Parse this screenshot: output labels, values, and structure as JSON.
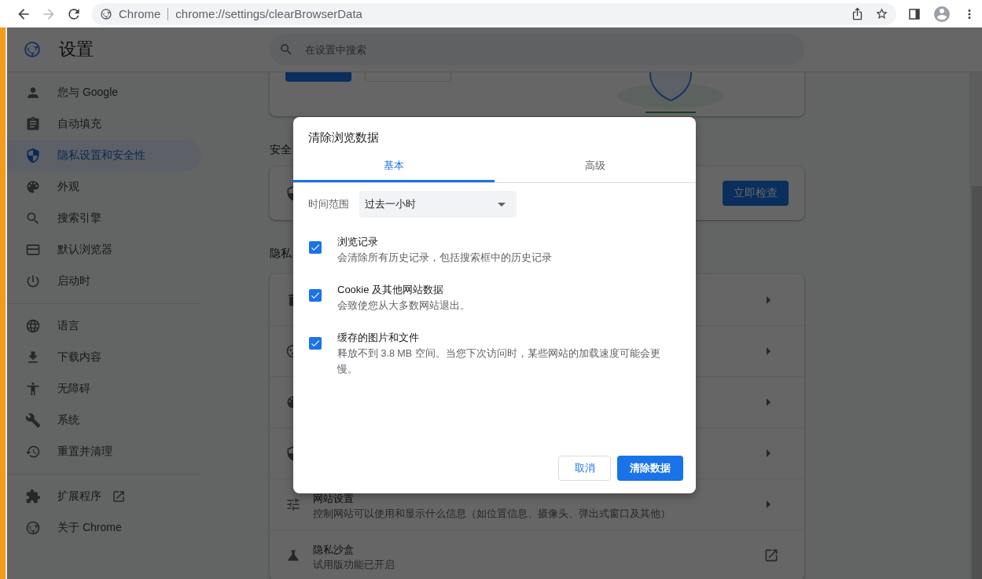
{
  "toolbar": {
    "back_disabled": false,
    "forward_disabled": true,
    "site_label": "Chrome",
    "url": "chrome://settings/clearBrowserData"
  },
  "header": {
    "title": "设置",
    "search_placeholder": "在设置中搜索"
  },
  "sidebar": {
    "groups": [
      [
        {
          "label": "您与 Google",
          "selected": false
        },
        {
          "label": "自动填充",
          "selected": false
        },
        {
          "label": "隐私设置和安全性",
          "selected": true
        },
        {
          "label": "外观",
          "selected": false
        },
        {
          "label": "搜索引擎",
          "selected": false
        },
        {
          "label": "默认浏览器",
          "selected": false
        },
        {
          "label": "启动时",
          "selected": false
        }
      ],
      [
        {
          "label": "语言",
          "selected": false
        },
        {
          "label": "下载内容",
          "selected": false
        },
        {
          "label": "无障碍",
          "selected": false
        },
        {
          "label": "系统",
          "selected": false
        },
        {
          "label": "重置并清理",
          "selected": false
        }
      ],
      [
        {
          "label": "扩展程序",
          "selected": false,
          "external": true
        },
        {
          "label": "关于 Chrome",
          "selected": false
        }
      ]
    ]
  },
  "main": {
    "safety_heading": "安全",
    "safety_button": "立即检查",
    "privacy_heading": "隐私",
    "privacy_rows": [
      {
        "kind": "arrow"
      },
      {
        "kind": "arrow"
      },
      {
        "kind": "arrow"
      },
      {
        "kind": "arrow"
      },
      {
        "kind": "arrow",
        "title": "网站设置",
        "subtitle": "控制网站可以使用和显示什么信息（如位置信息、摄像头、弹出式窗口及其他）"
      },
      {
        "kind": "external",
        "title": "隐私沙盒",
        "subtitle": "试用版功能已开启"
      }
    ]
  },
  "dialog": {
    "title": "清除浏览数据",
    "tabs": [
      {
        "label": "基本",
        "selected": true
      },
      {
        "label": "高级",
        "selected": false
      }
    ],
    "time_range": {
      "label": "时间范围",
      "value": "过去一小时"
    },
    "options": [
      {
        "title": "浏览记录",
        "description": "会清除所有历史记录，包括搜索框中的历史记录",
        "checked": true
      },
      {
        "title": "Cookie 及其他网站数据",
        "description": "会致使您从大多数网站退出。",
        "checked": true
      },
      {
        "title": "缓存的图片和文件",
        "description": "释放不到 3.8 MB 空间。当您下次访问时，某些网站的加载速度可能会更慢。",
        "checked": true
      }
    ],
    "buttons": [
      {
        "label": "取消",
        "kind": "secondary"
      },
      {
        "label": "清除数据",
        "kind": "primary"
      }
    ]
  }
}
